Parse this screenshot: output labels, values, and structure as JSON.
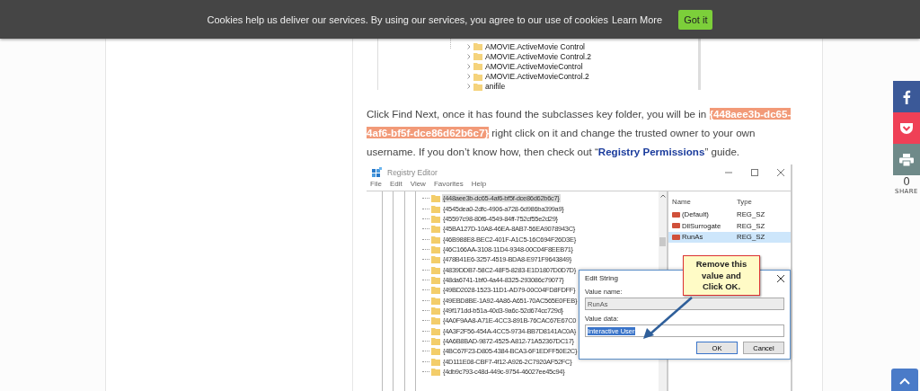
{
  "cookie_bar": {
    "message": "Cookies help us deliver our services. By using our services, you agree to our use of cookies",
    "link": "Learn More",
    "button": "Got it"
  },
  "article": {
    "first_image": {
      "rows": [
        "AMOVIE.ActiveMovie Control",
        "AMOVIE.ActiveMovie Control.2",
        "AMOVIE.ActiveMovieControl",
        "AMOVIE.ActiveMovieControl.2",
        "anifile"
      ]
    },
    "paragraph": {
      "before": "Click Find Next, once it has found the subclasses key folder, you will be in ",
      "highlight": "{448aee3b-dc65-4af6-bf5f-dce86d62b6c7}",
      "middle": " right click on it and change the trusted owner to your own username. If you don’t know how, then check out “",
      "link": "Registry Permissions",
      "after": "” guide."
    },
    "registry_editor": {
      "title": "Registry Editor",
      "menu": [
        "File",
        "Edit",
        "View",
        "Favorites",
        "Help"
      ],
      "tree_rows": [
        {
          "label": "{448aee3b-dc65-4af6-bf5f-dce86d62b6c7}",
          "selected": true
        },
        {
          "label": "{4545dea0-2dfc-4906-a728-6d986ba399a9}",
          "selected": false
        },
        {
          "label": "{45597c98-80f6-4549-84ff-752cf55e2d29}",
          "selected": false
        },
        {
          "label": "{45BA127D-10A8-46EA-8AB7-56EA9078943C}",
          "selected": false
        },
        {
          "label": "{46B988E8-BEC2-401F-A1C5-16C694F26D3E}",
          "selected": false
        },
        {
          "label": "{46C166AA-3108-11D4-9348-00C04F8EEB71}",
          "selected": false
        },
        {
          "label": "{478B41E6-3257-4519-BDA8-E971F9643849}",
          "selected": false
        },
        {
          "label": "{4839DDB7-58C2-48F5-8283-E1D1807D0D7D}",
          "selected": false
        },
        {
          "label": "{48da6741-1bf0-4a44-8325-293086c79077}",
          "selected": false
        },
        {
          "label": "{49BD2028-1523-11D1-AD79-00C04FD8FDFF}",
          "selected": false
        },
        {
          "label": "{49EBD8BE-1A92-4A86-A651-70AC565E0FEB}",
          "selected": false
        },
        {
          "label": "{49f171dd-b51a-40d3-9a6c-52d674cc729d}",
          "selected": false
        },
        {
          "label": "{4A0F9AA8-A71E-4CC3-891B-76CAC67E67C0",
          "selected": false
        },
        {
          "label": "{4A3F2F56-454A-4CC5-9734-BB7D8141AC0A}",
          "selected": false
        },
        {
          "label": "{4A6B8BAD-9872-4525-A812-71A52367DC17}",
          "selected": false
        },
        {
          "label": "{4BC67F23-D805-4384-BCA3-6F1EDFF50E2C}",
          "selected": false
        },
        {
          "label": "{4D111E08-CBF7-4f12-A926-2C7920AF52FC}",
          "selected": false
        },
        {
          "label": "{4db9c793-c48d-449c-9754-46027ee45c94}",
          "selected": false
        }
      ],
      "values": {
        "columns": [
          "Name",
          "Type"
        ],
        "rows": [
          {
            "name": "(Default)",
            "type": "REG_SZ",
            "selected": false
          },
          {
            "name": "DllSurrogate",
            "type": "REG_SZ",
            "selected": false
          },
          {
            "name": "RunAs",
            "type": "REG_SZ",
            "selected": true
          }
        ]
      },
      "dialog": {
        "title": "Edit String",
        "value_name_label": "Value name:",
        "value_name": "RunAs",
        "value_data_label": "Value data:",
        "value_data": "Interactive User",
        "buttons": [
          "OK",
          "Cancel"
        ]
      },
      "callout": "Remove this value and Click OK."
    }
  },
  "share": {
    "buttons": [
      {
        "kind": "facebook"
      },
      {
        "kind": "pocket"
      },
      {
        "kind": "print"
      }
    ],
    "count": "0",
    "label": "SHARE"
  }
}
